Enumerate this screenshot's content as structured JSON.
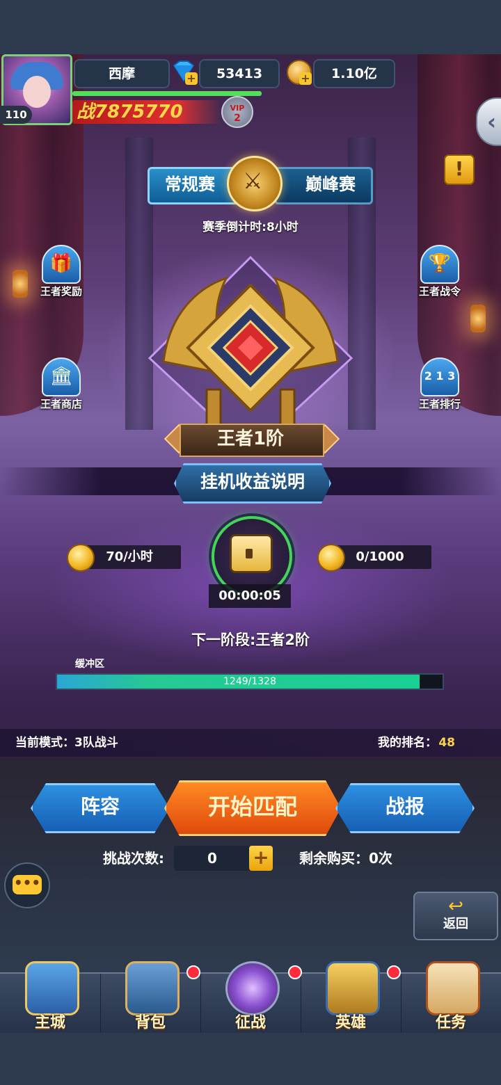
{
  "player": {
    "name": "西摩",
    "level": "110",
    "diamonds": "53413",
    "gold": "1.10亿",
    "power_prefix": "战",
    "power": "7875770",
    "vip_label": "VIP",
    "vip_level": "2"
  },
  "mode_tabs": {
    "regular": "常规赛",
    "peak": "巅峰赛",
    "selected": "regular"
  },
  "season_countdown": "赛季倒计时:8小时",
  "features": {
    "king_reward": "王者奖励",
    "king_pass": "王者战令",
    "king_shop": "王者商店",
    "king_ranking": "王者排行"
  },
  "rank": {
    "title": "王者1阶"
  },
  "explain_button": "挂机收益说明",
  "idle_income": {
    "rate": "70/小时",
    "stored": "0/1000",
    "timer": "00:00:05"
  },
  "next_stage": "下一阶段:王者2阶",
  "buffer": {
    "label": "缓冲区",
    "text": "1249/1328",
    "current": 1249,
    "max": 1328
  },
  "status": {
    "mode_text": "当前模式：3队战斗",
    "rank_label": "我的排名：",
    "rank_value": "48"
  },
  "actions": {
    "lineup": "阵容",
    "start_match": "开始匹配",
    "battle_report": "战报"
  },
  "challenge": {
    "label": "挑战次数:",
    "count": "0",
    "remaining_buy": "剩余购买：0次"
  },
  "back_label": "返回",
  "nav": [
    {
      "label": "主城",
      "red_dot": false
    },
    {
      "label": "背包",
      "red_dot": true
    },
    {
      "label": "征战",
      "red_dot": true
    },
    {
      "label": "英雄",
      "red_dot": true
    },
    {
      "label": "任务",
      "red_dot": false
    }
  ],
  "colors": {
    "accent_gold": "#ffd24a",
    "progress_teal": "#1ad095",
    "power_red": "#e03030",
    "start_orange": "#ff8a24",
    "button_blue": "#2e8fe0"
  }
}
